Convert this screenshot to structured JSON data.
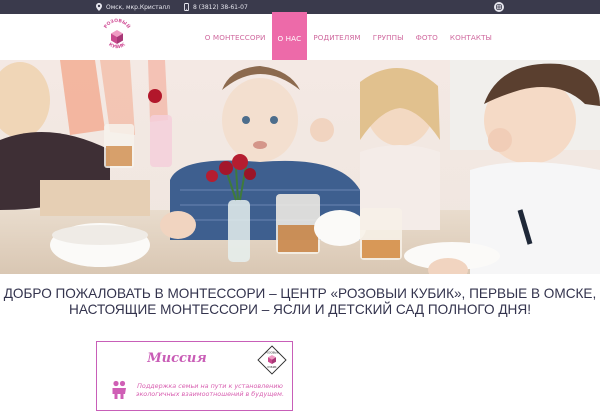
{
  "topbar": {
    "address": "Омск, мкр.Кристалл",
    "phone": "8 (3812) 38-61-07",
    "social_icon": "instagram-icon"
  },
  "logo": {
    "text_top": "РОЗОВЫЙ",
    "text_bottom": "КУБИК",
    "color": "#d2559a"
  },
  "nav": {
    "items": [
      {
        "label": "О МОНТЕССОРИ"
      },
      {
        "label": "О НАС"
      },
      {
        "label": "РОДИТЕЛЯМ"
      },
      {
        "label": "ГРУППЫ"
      },
      {
        "label": "ФОТО"
      },
      {
        "label": "КОНТАКТЫ"
      }
    ],
    "active_index": 1
  },
  "hero": {
    "image": "children-at-table-photo"
  },
  "welcome": {
    "line1": "ДОБРО ПОЖАЛОВАТЬ В МОНТЕССОРИ – ЦЕНТР «РОЗОВЫИ КУБИК», ПЕРВЫЕ В ОМСКЕ,",
    "line2": "НАСТОЯЩИЕ МОНТЕССОРИ – ЯСЛИ И ДЕТСКИЙ САД ПОЛНОГО ДНЯ!"
  },
  "mission": {
    "title": "Миссия",
    "text": "Поддержка семьи на пути к установлению экологичных взаимоотношений в будущем.",
    "badge_text_top": "РОЗОВЫЙ",
    "badge_text_bottom": "КУБИК"
  },
  "colors": {
    "accent": "#ed6aa9",
    "topbar": "#3a3a4c",
    "nav_text": "#d06a9f",
    "heading": "#33334d"
  }
}
